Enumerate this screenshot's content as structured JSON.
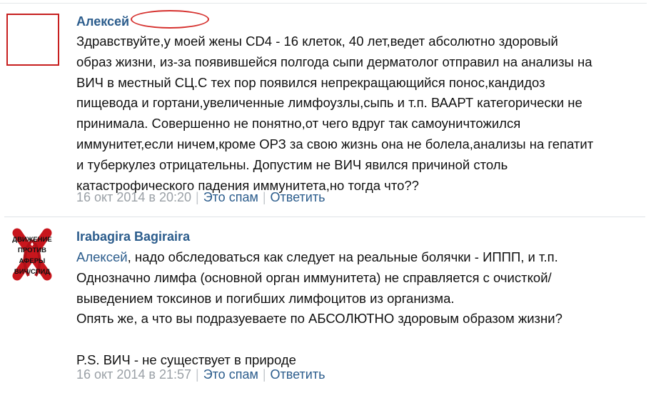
{
  "comments": [
    {
      "author": "Алексей",
      "text": "Здравствуйте,у моей жены CD4 - 16 клеток, 40 лет,ведет абсолютно здоровый\nобраз жизни, из-за появившейся полгода сыпи дерматолог отправил на анализы на\nВИЧ в местный СЦ.С тех пор появился непрекращающийся понос,кандидоз\nпищевода и гортани,увеличенные лимфоузлы,сыпь и т.п. ВААРТ категорически не\nпринимала. Совершенно не понятно,от чего вдруг так самоуничтожился\nиммунитет,если ничем,кроме ОРЗ за свою жизнь она не болела,анализы на гепатит\nи туберкулез отрицательны. Допустим не ВИЧ явился причиной столь\nкатастрофического падения иммунитета,но тогда что??",
      "date": "16 окт 2014 в 20:20",
      "spam_label": "Это спам",
      "reply_label": "Ответить"
    },
    {
      "author": "Irabagira Bagiraira",
      "reply_to": "Алексей",
      "text": ", надо обследоваться как следует на реальные болячки - ИППП, и т.п.\nОднозначно лимфа (основной орган иммунитета) не справляется с очисткой/\nвыведением токсинов и погибших лимфоцитов из организма.\nОпять же, а что вы подразуеваете по АБСОЛЮТНО здоровым образом жизни?\n\nP.S. ВИЧ - не существует в природе",
      "date": "16 окт 2014 в 21:57",
      "spam_label": "Это спам",
      "reply_label": "Ответить",
      "avatar_text": [
        "ДВИЖЕНИЕ",
        "ПРОТИВ",
        "АФЕРЫ",
        "ВИЧ/СПИД"
      ]
    }
  ],
  "colors": {
    "link": "#2b5c8c",
    "meta": "#9aa0a6",
    "redaction": "#d6322f"
  }
}
